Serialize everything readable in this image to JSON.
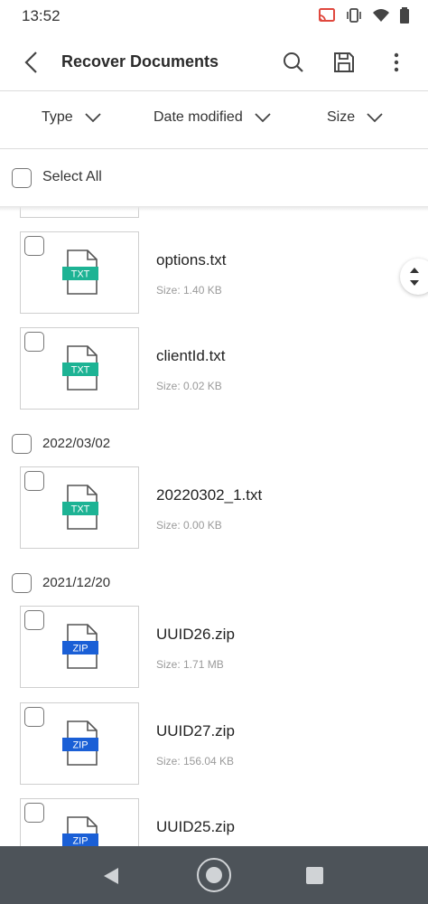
{
  "status_bar": {
    "time": "13:52",
    "icons": [
      "cast-icon",
      "vibrate-icon",
      "wifi-icon",
      "battery-icon"
    ]
  },
  "header": {
    "title": "Recover Documents",
    "icons": [
      "back-icon",
      "search-icon",
      "save-icon",
      "more-vert-icon"
    ]
  },
  "filters": [
    {
      "label": "Type"
    },
    {
      "label": "Date modified"
    },
    {
      "label": "Size"
    }
  ],
  "select_all": {
    "label": "Select All"
  },
  "groups": [
    {
      "date": "",
      "files": [
        {
          "name": "options.txt",
          "size": "Size: 1.40 KB",
          "type": "TXT"
        },
        {
          "name": "clientId.txt",
          "size": "Size: 0.02 KB",
          "type": "TXT"
        }
      ]
    },
    {
      "date": "2022/03/02",
      "files": [
        {
          "name": "20220302_1.txt",
          "size": "Size: 0.00 KB",
          "type": "TXT"
        }
      ]
    },
    {
      "date": "2021/12/20",
      "files": [
        {
          "name": "UUID26.zip",
          "size": "Size: 1.71 MB",
          "type": "ZIP"
        },
        {
          "name": "UUID27.zip",
          "size": "Size: 156.04 KB",
          "type": "ZIP"
        },
        {
          "name": "UUID25.zip",
          "size": "",
          "type": "ZIP"
        }
      ]
    }
  ],
  "colors": {
    "txt_badge": "#1db394",
    "zip_badge": "#1a5fd6",
    "nav_bar": "#4d5359"
  },
  "nav": {
    "icons": [
      "nav-back-icon",
      "nav-home-icon",
      "nav-recents-icon"
    ]
  }
}
